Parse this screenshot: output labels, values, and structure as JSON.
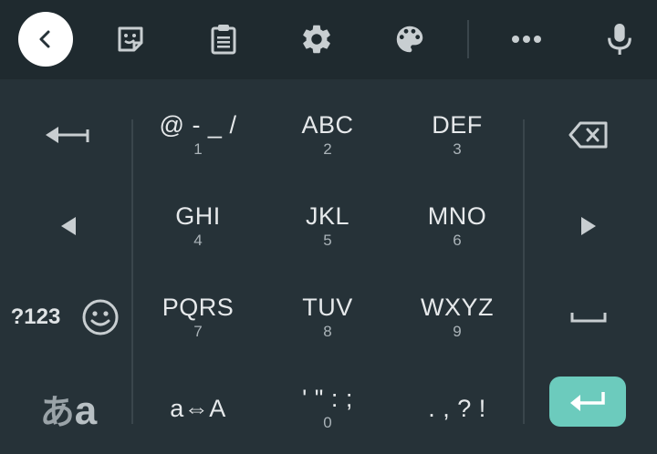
{
  "toolbar": {
    "icons": [
      "back-icon",
      "sticker-icon",
      "clipboard-icon",
      "settings-icon",
      "theme-palette-icon",
      "more-icon",
      "microphone-icon"
    ]
  },
  "keys": {
    "symbols_row1": {
      "main": "@ - _ /",
      "sub": "1"
    },
    "abc": {
      "main": "ABC",
      "sub": "2"
    },
    "def": {
      "main": "DEF",
      "sub": "3"
    },
    "ghi": {
      "main": "GHI",
      "sub": "4"
    },
    "jkl": {
      "main": "JKL",
      "sub": "5"
    },
    "mno": {
      "main": "MNO",
      "sub": "6"
    },
    "pqrs": {
      "main": "PQRS",
      "sub": "7"
    },
    "tuv": {
      "main": "TUV",
      "sub": "8"
    },
    "wxyz": {
      "main": "WXYZ",
      "sub": "9"
    },
    "case_toggle": {
      "main": "a⇔A"
    },
    "quotes": {
      "main": "' \" : ;",
      "sub": "0"
    },
    "punct": {
      "main": ". , ? !"
    },
    "numbers_mode": "?123",
    "lang_small": "あ",
    "lang_big": "a"
  },
  "colors": {
    "background": "#263238",
    "toolbar": "#1f2a2f",
    "enter_key": "#6ccbbd"
  }
}
